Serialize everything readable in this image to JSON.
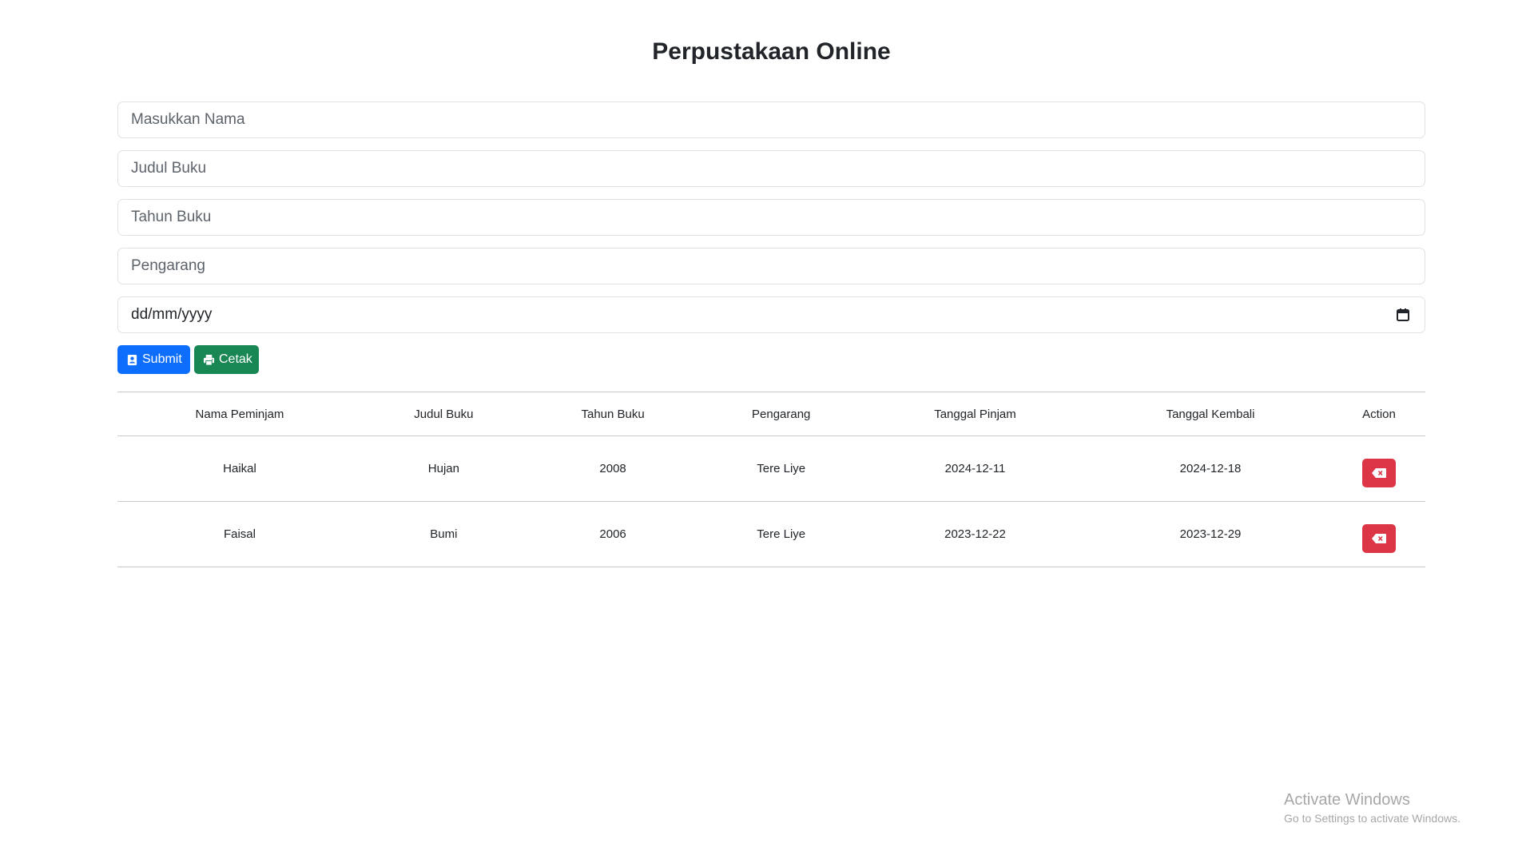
{
  "header": {
    "title": "Perpustakaan Online"
  },
  "form": {
    "nama_placeholder": "Masukkan Nama",
    "judul_placeholder": "Judul Buku",
    "tahun_placeholder": "Tahun Buku",
    "pengarang_placeholder": "Pengarang",
    "date_placeholder": "dd/mm/yyyy"
  },
  "buttons": {
    "submit_label": "Submit",
    "cetak_label": "Cetak"
  },
  "table": {
    "columns": [
      "Nama Peminjam",
      "Judul Buku",
      "Tahun Buku",
      "Pengarang",
      "Tanggal Pinjam",
      "Tanggal Kembali",
      "Action"
    ],
    "rows": [
      {
        "nama": "Haikal",
        "judul": "Hujan",
        "tahun": "2008",
        "pengarang": "Tere Liye",
        "pinjam": "2024-12-11",
        "kembali": "2024-12-18"
      },
      {
        "nama": "Faisal",
        "judul": "Bumi",
        "tahun": "2006",
        "pengarang": "Tere Liye",
        "pinjam": "2023-12-22",
        "kembali": "2023-12-29"
      }
    ]
  },
  "watermark": {
    "title": "Activate Windows",
    "subtitle": "Go to Settings to activate Windows."
  },
  "colors": {
    "primary": "#0d6efd",
    "success": "#198754",
    "danger": "#dc3545"
  },
  "icons": {
    "submit": "address-card-icon",
    "cetak": "printer-icon",
    "delete": "delete-backspace-icon",
    "date": "calendar-icon"
  }
}
